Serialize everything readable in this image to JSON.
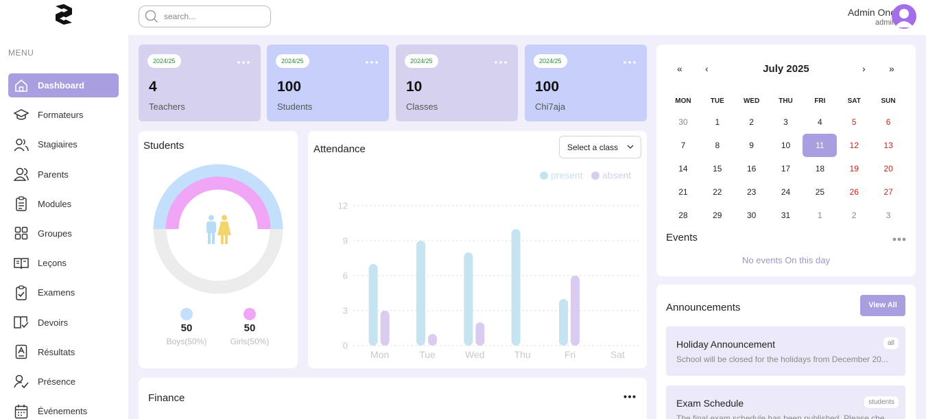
{
  "sidebar": {
    "menu_title": "MENU",
    "items": [
      {
        "label": "Dashboard",
        "icon": "home-icon",
        "active": true
      },
      {
        "label": "Formateurs",
        "icon": "graduation-cap-icon"
      },
      {
        "label": "Stagiaires",
        "icon": "users-icon"
      },
      {
        "label": "Parents",
        "icon": "user-pair-icon"
      },
      {
        "label": "Modules",
        "icon": "clipboard-list-icon"
      },
      {
        "label": "Groupes",
        "icon": "grid-icon"
      },
      {
        "label": "Leçons",
        "icon": "book-open-icon"
      },
      {
        "label": "Examens",
        "icon": "clipboard-check-icon"
      },
      {
        "label": "Devoirs",
        "icon": "book-check-icon"
      },
      {
        "label": "Résultats",
        "icon": "report-icon"
      },
      {
        "label": "Présence",
        "icon": "user-check-icon"
      },
      {
        "label": "Événements",
        "icon": "calendar-icon"
      }
    ]
  },
  "header": {
    "search_placeholder": "search...",
    "user_name": "Admin One",
    "user_role": "admin"
  },
  "stats": [
    {
      "year": "2024/25",
      "value": "4",
      "label": "Teachers",
      "color": "#d6d1ee"
    },
    {
      "year": "2024/25",
      "value": "100",
      "label": "Students",
      "color": "#c7cffb"
    },
    {
      "year": "2024/25",
      "value": "10",
      "label": "Classes",
      "color": "#d6d1ee"
    },
    {
      "year": "2024/25",
      "value": "100",
      "label": "Chi7aja",
      "color": "#c7cffb"
    }
  ],
  "students": {
    "title": "Students",
    "boys_count": "50",
    "boys_label": "Boys(50%)",
    "girls_count": "50",
    "girls_label": "Girls(50%)",
    "boys_color": "#c3dffb",
    "girls_color": "#f1a6f5"
  },
  "attendance": {
    "title": "Attendance",
    "select_label": "Select a class",
    "legend_present": "present",
    "legend_absent": "absent"
  },
  "chart_data": {
    "type": "bar",
    "categories": [
      "Mon",
      "Tue",
      "Wed",
      "Thu",
      "Fri",
      "Sat"
    ],
    "series": [
      {
        "name": "present",
        "values": [
          7,
          9,
          8,
          10,
          4,
          0
        ],
        "color": "#c5e4ef"
      },
      {
        "name": "absent",
        "values": [
          3,
          1,
          2,
          0,
          6,
          0
        ],
        "color": "#d9ccf0"
      }
    ],
    "yticks": [
      0,
      3,
      6,
      9,
      12
    ],
    "ylim": [
      0,
      12
    ],
    "grid": true,
    "legend": "top-right"
  },
  "finance": {
    "title": "Finance"
  },
  "calendar": {
    "prev_year": "«",
    "prev_month": "‹",
    "next_month": "›",
    "next_year": "»",
    "month": "July 2025",
    "weekdays": [
      "MON",
      "TUE",
      "WED",
      "THU",
      "FRI",
      "SAT",
      "SUN"
    ],
    "weeks": [
      [
        "30",
        "1",
        "2",
        "3",
        "4",
        "5",
        "6"
      ],
      [
        "7",
        "8",
        "9",
        "10",
        "11",
        "12",
        "13"
      ],
      [
        "14",
        "15",
        "16",
        "17",
        "18",
        "19",
        "20"
      ],
      [
        "21",
        "22",
        "23",
        "24",
        "25",
        "26",
        "27"
      ],
      [
        "28",
        "29",
        "30",
        "31",
        "1",
        "2",
        "3"
      ]
    ],
    "selected": "11"
  },
  "events": {
    "title": "Events",
    "empty": "No events On this day"
  },
  "announcements": {
    "title": "Announcements",
    "view_all": "View All",
    "items": [
      {
        "title": "Holiday Announcement",
        "desc": "School will be closed for the holidays from December 20...",
        "tag": "all"
      },
      {
        "title": "Exam Schedule",
        "desc": "The final exam schedule has been published. Please che...",
        "tag": "students"
      }
    ]
  }
}
